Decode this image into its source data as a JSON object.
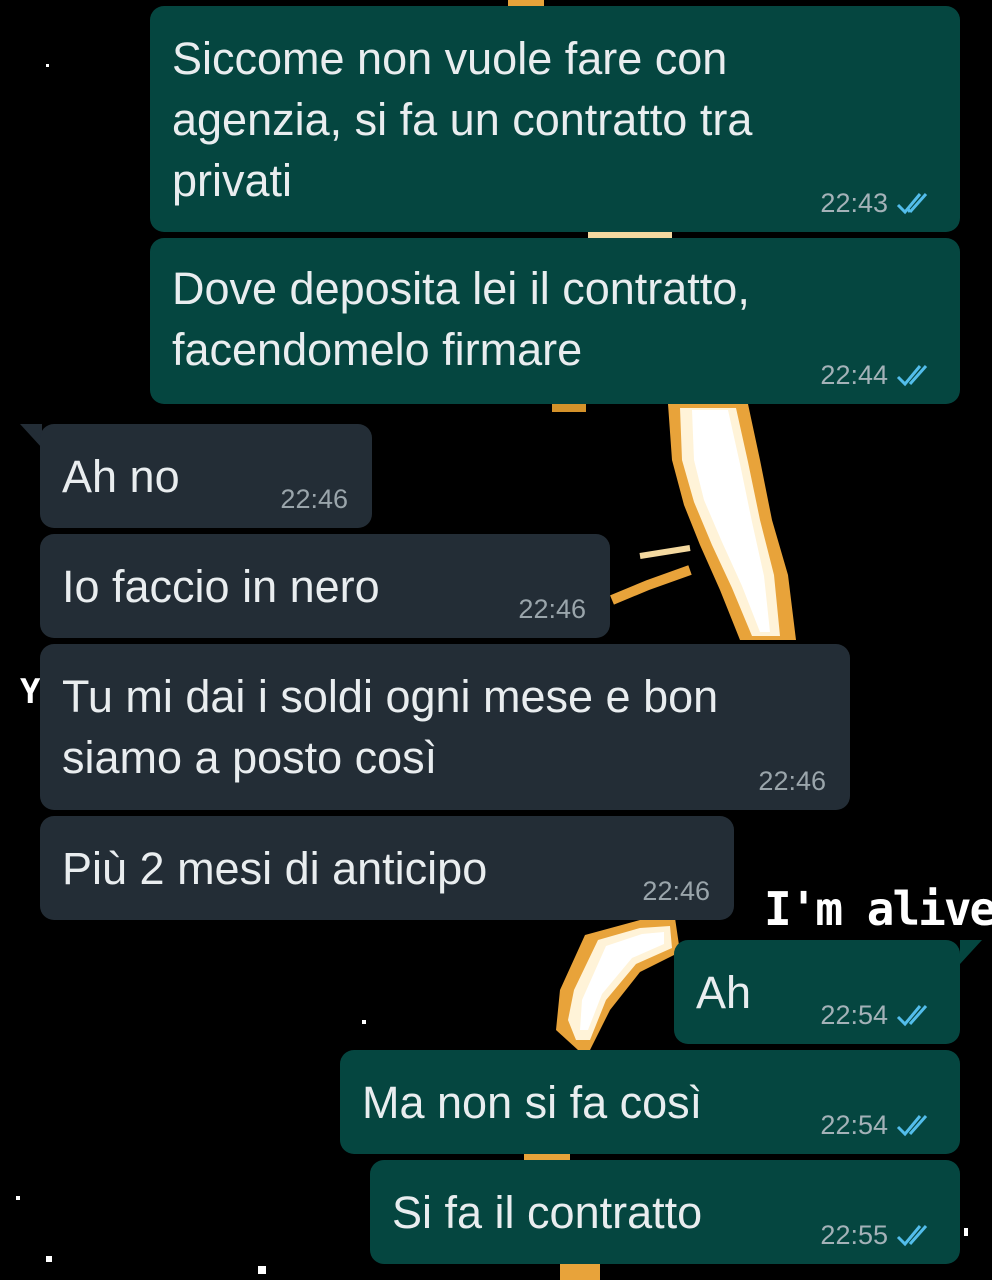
{
  "wallpaper": {
    "overlay_text": "I'm alive.",
    "stray_glyph": "Y"
  },
  "colors": {
    "outgoing_bubble": "#054640",
    "incoming_bubble": "#232d36",
    "read_ticks": "#53bdeb",
    "background": "#000000"
  },
  "messages": [
    {
      "direction": "outgoing",
      "text": "Siccome non vuole fare con\nagenzia, si fa un contratto tra\nprivati",
      "time": "22:43",
      "status": "read"
    },
    {
      "direction": "outgoing",
      "text": "Dove deposita lei il contratto,\nfacendomelo firmare",
      "time": "22:44",
      "status": "read"
    },
    {
      "direction": "incoming",
      "text": "Ah no",
      "time": "22:46"
    },
    {
      "direction": "incoming",
      "text": "Io faccio in nero",
      "time": "22:46"
    },
    {
      "direction": "incoming",
      "text": "Tu mi dai i soldi ogni mese e bon\nsiamo a posto così",
      "time": "22:46"
    },
    {
      "direction": "incoming",
      "text": "Più 2 mesi di anticipo",
      "time": "22:46"
    },
    {
      "direction": "outgoing",
      "text": "Ah",
      "time": "22:54",
      "status": "read"
    },
    {
      "direction": "outgoing",
      "text": "Ma non si fa così",
      "time": "22:54",
      "status": "read"
    },
    {
      "direction": "outgoing",
      "text": "Si fa il contratto",
      "time": "22:55",
      "status": "read"
    }
  ]
}
